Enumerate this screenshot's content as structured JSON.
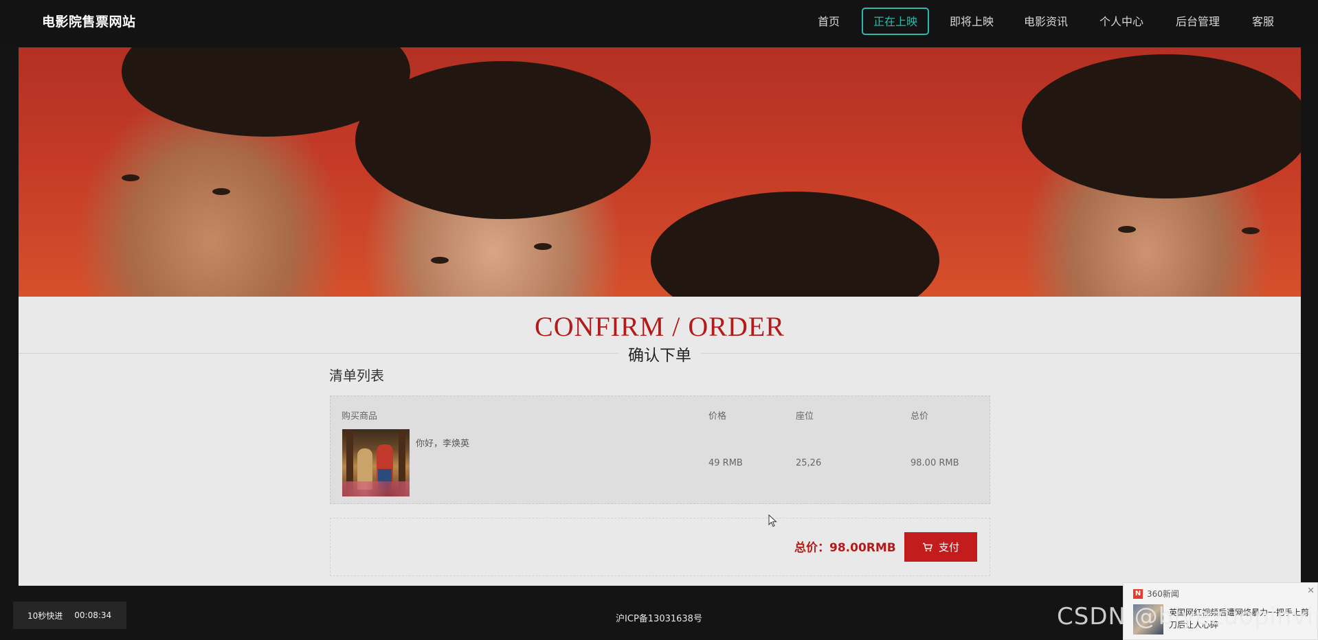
{
  "site": {
    "logo": "电影院售票网站"
  },
  "nav": {
    "items": [
      {
        "label": "首页"
      },
      {
        "label": "正在上映"
      },
      {
        "label": "即将上映"
      },
      {
        "label": "电影资讯"
      },
      {
        "label": "个人中心"
      },
      {
        "label": "后台管理"
      },
      {
        "label": "客服"
      }
    ],
    "active_index": 1,
    "active_color": "#2bbbad"
  },
  "page": {
    "title_en": "CONFIRM / ORDER",
    "title_cn": "确认下单",
    "list_title": "清单列表"
  },
  "order": {
    "headers": {
      "product": "购买商品",
      "price": "价格",
      "seat": "座位",
      "total": "总价"
    },
    "rows": [
      {
        "movie": "你好，李焕英",
        "price": "49 RMB",
        "seat": "25,26",
        "total": "98.00 RMB"
      }
    ]
  },
  "summary": {
    "total_text": "总价：98.00RMB",
    "pay_label": "支付",
    "accent_color": "#c31c1c"
  },
  "footer": {
    "icp": "沪ICP备13031638号"
  },
  "player": {
    "skip_label": "10秒快进",
    "time": "00:08:34"
  },
  "news_popup": {
    "source": "360新闻",
    "headline": "英国网红视频后遭网络暴力一把手上剪刀后让人心碎"
  },
  "watermark": {
    "text": "CSDN @biyezuopinvip"
  }
}
